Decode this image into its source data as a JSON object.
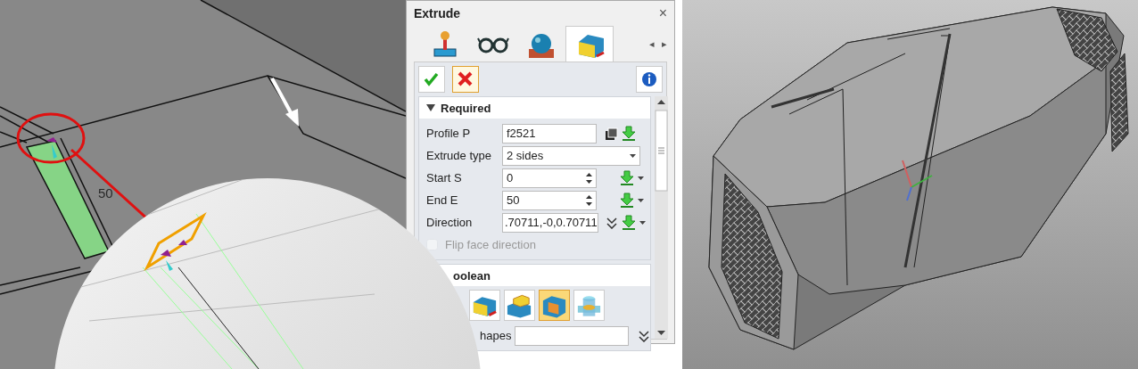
{
  "viewport_left": {
    "dimension_label": "50"
  },
  "dialog": {
    "title": "Extrude",
    "close_glyph": "×",
    "tabs": [
      {
        "kind": "joystick",
        "selected": false
      },
      {
        "kind": "glasses",
        "selected": false
      },
      {
        "kind": "sphere",
        "selected": false
      },
      {
        "kind": "box",
        "selected": true
      }
    ],
    "tab_scroll": [
      "◂",
      "▸"
    ],
    "actions": [
      {
        "kind": "ok"
      },
      {
        "kind": "cancel"
      },
      {
        "kind": "info"
      }
    ],
    "sections": [
      {
        "title": "Required",
        "expanded": true,
        "rows": [
          {
            "kind": "pick",
            "label": "Profile P",
            "value": "f2521"
          },
          {
            "kind": "combo",
            "label": "Extrude type",
            "value": "2 sides"
          },
          {
            "kind": "spin",
            "label": "Start S",
            "value": "0"
          },
          {
            "kind": "spin",
            "label": "End E",
            "value": "50"
          },
          {
            "kind": "vector",
            "label": "Direction",
            "value": ".70711,-0,0.70711"
          },
          {
            "kind": "checkbox",
            "label": "Flip face direction",
            "checked": false,
            "disabled": true
          }
        ]
      },
      {
        "title": "oolean",
        "ops": [
          {
            "kind": "add",
            "selected": false
          },
          {
            "kind": "subtract",
            "selected": false
          },
          {
            "kind": "intersect",
            "selected": true
          },
          {
            "kind": "cylinder",
            "selected": false
          }
        ],
        "shapes_label": "hapes"
      }
    ]
  }
}
